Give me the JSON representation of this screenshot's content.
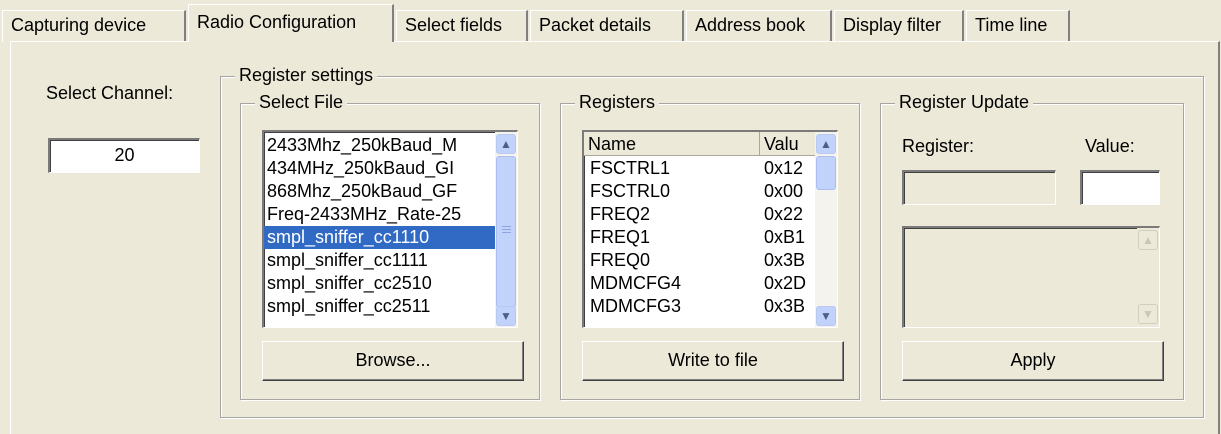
{
  "tabs": [
    {
      "label": "Capturing device"
    },
    {
      "label": "Radio Configuration"
    },
    {
      "label": "Select fields"
    },
    {
      "label": "Packet details"
    },
    {
      "label": "Address book"
    },
    {
      "label": "Display filter"
    },
    {
      "label": "Time line"
    }
  ],
  "channel": {
    "label": "Select Channel:",
    "value": "20"
  },
  "register_settings": {
    "title": "Register settings",
    "select_file": {
      "title": "Select File",
      "items": [
        "2433Mhz_250kBaud_M",
        "434MHz_250kBaud_GI",
        "868Mhz_250kBaud_GF",
        "Freq-2433MHz_Rate-25",
        "smpl_sniffer_cc1110",
        "smpl_sniffer_cc1111",
        "smpl_sniffer_cc2510",
        "smpl_sniffer_cc2511"
      ],
      "selected": "smpl_sniffer_cc1110",
      "browse_label": "Browse..."
    },
    "registers": {
      "title": "Registers",
      "columns": [
        "Name",
        "Valu"
      ],
      "rows": [
        {
          "name": "FSCTRL1",
          "value": "0x12"
        },
        {
          "name": "FSCTRL0",
          "value": "0x00"
        },
        {
          "name": "FREQ2",
          "value": "0x22"
        },
        {
          "name": "FREQ1",
          "value": "0xB1"
        },
        {
          "name": "FREQ0",
          "value": "0x3B"
        },
        {
          "name": "MDMCFG4",
          "value": "0x2D"
        },
        {
          "name": "MDMCFG3",
          "value": "0x3B"
        }
      ],
      "write_label": "Write to file"
    },
    "update": {
      "title": "Register Update",
      "register_label": "Register:",
      "value_label": "Value:",
      "register_value": "",
      "value_value": "",
      "description": "",
      "apply_label": "Apply"
    }
  },
  "colors": {
    "selection": "#316ac5",
    "face": "#ece9d8",
    "scroll_accent": "#c1d3fb"
  },
  "icons": {
    "scroll_up": "chevron-up-icon",
    "scroll_down": "chevron-down-icon",
    "thumb_grip": "grip-icon"
  }
}
